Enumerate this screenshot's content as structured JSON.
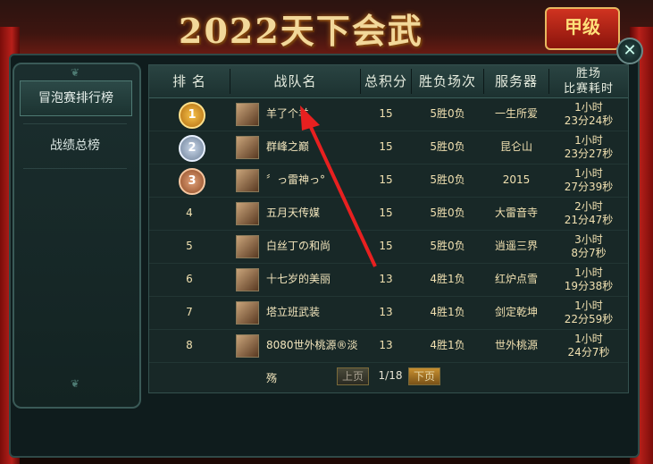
{
  "banner": {
    "title": "2022天下会武",
    "badge": "甲级"
  },
  "close": {
    "glyph": "✕"
  },
  "sidebar": {
    "items": [
      {
        "label": "冒泡赛排行榜",
        "active": true
      },
      {
        "label": "战绩总榜",
        "active": false
      }
    ]
  },
  "table": {
    "headers": {
      "rank": "排 名",
      "team": "战队名",
      "score": "总积分",
      "record": "胜负场次",
      "server": "服务器",
      "time_line1": "胜场",
      "time_line2": "比赛耗时"
    },
    "rows": [
      {
        "rank": "1",
        "team": "羊了个羊",
        "score": "15",
        "record": "5胜0负",
        "server": "一生所爱",
        "time1": "1小时",
        "time2": "23分24秒"
      },
      {
        "rank": "2",
        "team": "群峰之巅",
        "score": "15",
        "record": "5胜0负",
        "server": "昆仑山",
        "time1": "1小时",
        "time2": "23分27秒"
      },
      {
        "rank": "3",
        "team": "〞っ雷神っ°",
        "score": "15",
        "record": "5胜0负",
        "server": "2015",
        "time1": "1小时",
        "time2": "27分39秒"
      },
      {
        "rank": "4",
        "team": "五月天传媒",
        "score": "15",
        "record": "5胜0负",
        "server": "大雷音寺",
        "time1": "2小时",
        "time2": "21分47秒"
      },
      {
        "rank": "5",
        "team": "白丝丁の和尚",
        "score": "15",
        "record": "5胜0负",
        "server": "逍遥三界",
        "time1": "3小时",
        "time2": "8分7秒"
      },
      {
        "rank": "6",
        "team": "十七岁的美丽",
        "score": "13",
        "record": "4胜1负",
        "server": "红炉点雪",
        "time1": "1小时",
        "time2": "19分38秒"
      },
      {
        "rank": "7",
        "team": "塔立班武装",
        "score": "13",
        "record": "4胜1负",
        "server": "剑定乾坤",
        "time1": "1小时",
        "time2": "22分59秒"
      },
      {
        "rank": "8",
        "team": "8080世外桃源®淡殇",
        "score": "13",
        "record": "4胜1负",
        "server": "世外桃源",
        "time1": "1小时",
        "time2": "24分7秒"
      }
    ]
  },
  "pager": {
    "prev": "上页",
    "page": "1/18",
    "next": "下页"
  },
  "colors": {
    "accent_arrow": "#e82020",
    "gold": "#f0e0b0"
  }
}
